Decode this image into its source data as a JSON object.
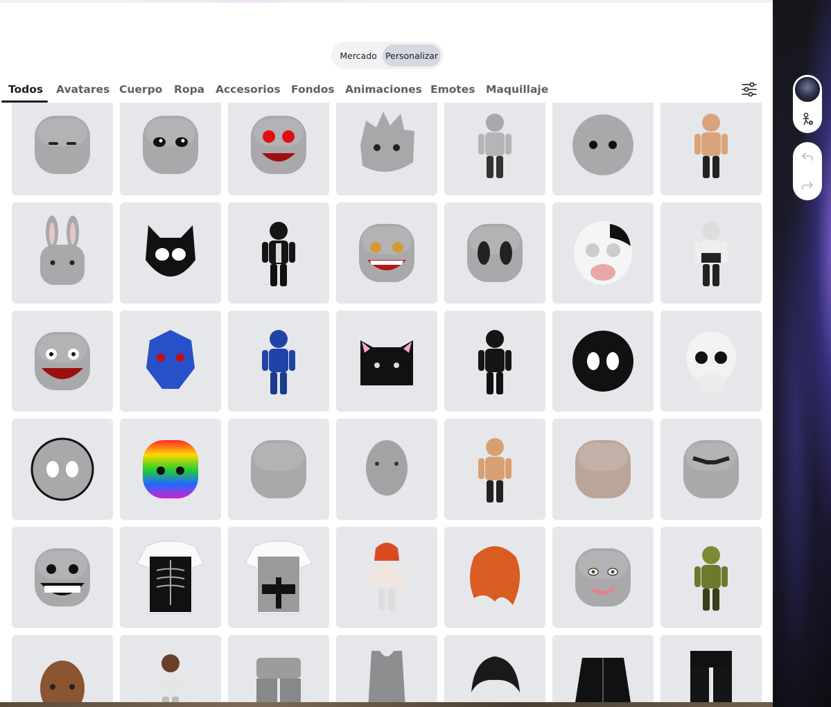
{
  "segmented": {
    "options": [
      "Mercado",
      "Personalizar"
    ],
    "selected": "Personalizar"
  },
  "tabs": [
    {
      "label": "Todos",
      "active": true
    },
    {
      "label": "Avatares"
    },
    {
      "label": "Cuerpo"
    },
    {
      "label": "Ropa"
    },
    {
      "label": "Accesorios"
    },
    {
      "label": "Fondos"
    },
    {
      "label": "Animaciones"
    },
    {
      "label": "Emotes"
    },
    {
      "label": "Maquillaje"
    }
  ],
  "toolbar": {
    "filter_icon": "sliders-icon"
  },
  "side_panel": {
    "avatar_icon": "avatar-thumbnail",
    "settings_icon": "avatar-settings-icon",
    "undo_icon": "undo-icon",
    "redo_icon": "redo-icon"
  },
  "colors": {
    "card_bg": "#e6e7eb",
    "active_tab": "#1c1d21",
    "inactive_tab": "#5c5f66",
    "selected_segment": "#d6d8df"
  },
  "items": [
    [
      "face-sleepy",
      "face-anime-eyes",
      "face-red-smile",
      "head-spiky-hair",
      "avatar-gray-hoodie",
      "face-dot-eyes",
      "avatar-tan-body"
    ],
    [
      "head-bunny",
      "mask-black-cat",
      "avatar-black-cat",
      "face-swirl-grin",
      "face-oval-eyes",
      "mask-cow",
      "avatar-cow-girl"
    ],
    [
      "face-crazy-grin",
      "mask-blue-skull",
      "avatar-blue-skeleton",
      "head-black-cat",
      "avatar-black-cat-block",
      "face-black-ball",
      "head-skull"
    ],
    [
      "face-round-eyes",
      "head-rainbow",
      "head-plain",
      "head-bald-realistic",
      "avatar-muscle",
      "head-marble",
      "face-angry-brow"
    ],
    [
      "face-big-teeth",
      "shirt-ribcage",
      "shirt-suit",
      "avatar-red-hair",
      "hair-orange",
      "face-woman",
      "avatar-goblin"
    ],
    [
      "head-brown",
      "avatar-girl",
      "pants-gray",
      "shirt-tank-top",
      "hair-black",
      "jacket-hoodie",
      "pants-black"
    ]
  ]
}
